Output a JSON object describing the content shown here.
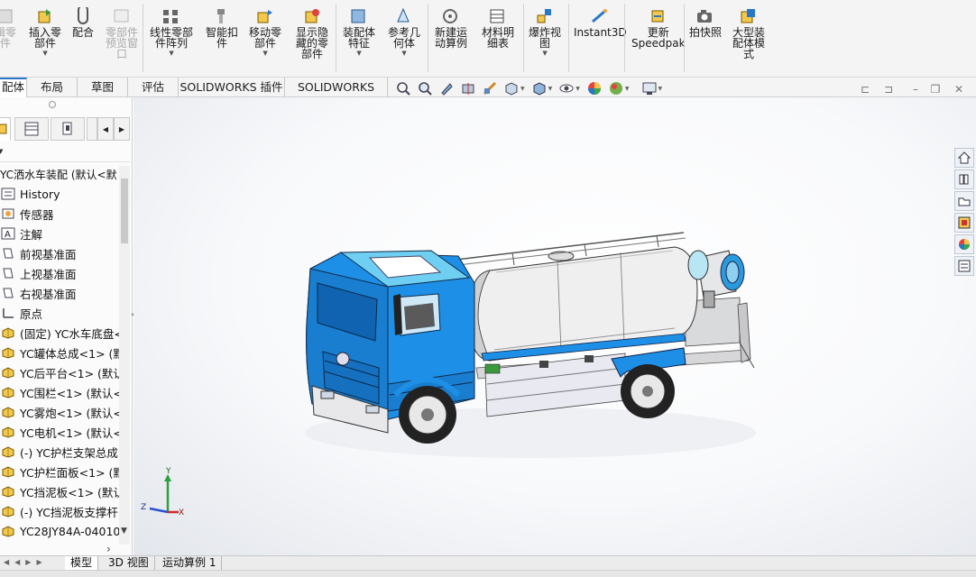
{
  "ribbon": {
    "buttons": [
      {
        "label": "插入零\n部件",
        "disabled": false,
        "icon": "insert-component-icon"
      },
      {
        "label": "配合",
        "disabled": false,
        "icon": "mate-icon"
      },
      {
        "label": "零部件\n预览窗\n口",
        "disabled": true,
        "icon": "component-preview-icon"
      },
      {
        "label": "线性零部\n件阵列",
        "disabled": false,
        "icon": "linear-pattern-icon"
      },
      {
        "label": "智能扣\n件",
        "disabled": false,
        "icon": "smart-fasteners-icon"
      },
      {
        "label": "移动零\n部件",
        "disabled": false,
        "icon": "move-component-icon"
      },
      {
        "label": "显示隐\n藏的零\n部件",
        "disabled": false,
        "icon": "show-hidden-icon"
      },
      {
        "label": "装配体\n特征",
        "disabled": false,
        "icon": "assembly-features-icon"
      },
      {
        "label": "参考几\n何体",
        "disabled": false,
        "icon": "reference-geometry-icon"
      },
      {
        "label": "新建运\n动算例",
        "disabled": false,
        "icon": "motion-study-icon"
      },
      {
        "label": "材料明\n细表",
        "disabled": false,
        "icon": "bom-icon"
      },
      {
        "label": "爆炸视\n图",
        "disabled": false,
        "icon": "exploded-view-icon"
      },
      {
        "label": "Instant3D",
        "disabled": false,
        "icon": "instant3d-icon"
      },
      {
        "label": "更新\nSpeedpak",
        "disabled": false,
        "icon": "speedpak-icon"
      },
      {
        "label": "拍快照",
        "disabled": false,
        "icon": "snapshot-icon"
      },
      {
        "label": "大型装\n配体模\n式",
        "disabled": false,
        "icon": "large-assembly-icon"
      }
    ],
    "partial_left_label": "辑零\n件"
  },
  "command_tabs": [
    "配体",
    "布局",
    "草图",
    "评估",
    "SOLIDWORKS 插件",
    "SOLIDWORKS MBD"
  ],
  "feature_tree": {
    "root": "YC洒水车装配  (默认<默",
    "items": [
      {
        "label": "History",
        "icon": "history-icon"
      },
      {
        "label": "传感器",
        "icon": "sensor-icon"
      },
      {
        "label": "注解",
        "icon": "annotation-icon"
      },
      {
        "label": "前视基准面",
        "icon": "plane-icon"
      },
      {
        "label": "上视基准面",
        "icon": "plane-icon"
      },
      {
        "label": "右视基准面",
        "icon": "plane-icon"
      },
      {
        "label": "原点",
        "icon": "origin-icon"
      },
      {
        "label": "(固定) YC水车底盘<",
        "icon": "part-icon"
      },
      {
        "label": "YC罐体总成<1> (默",
        "icon": "part-icon"
      },
      {
        "label": "YC后平台<1> (默认",
        "icon": "part-icon"
      },
      {
        "label": "YC围栏<1> (默认<",
        "icon": "part-icon"
      },
      {
        "label": "YC雾炮<1> (默认<",
        "icon": "part-icon"
      },
      {
        "label": "YC电机<1> (默认<",
        "icon": "part-icon"
      },
      {
        "label": "(-) YC护栏支架总成",
        "icon": "part-icon"
      },
      {
        "label": "YC护栏面板<1> (默",
        "icon": "part-icon"
      },
      {
        "label": "YC挡泥板<1> (默认",
        "icon": "part-icon"
      },
      {
        "label": "(-) YC挡泥板支撑杆",
        "icon": "part-icon"
      },
      {
        "label": "YC28JY84A-04010",
        "icon": "part-icon"
      }
    ]
  },
  "bottom_tabs": [
    "模型",
    "3D 视图",
    "运动算例 1"
  ],
  "triad": {
    "x": "X",
    "y": "Y",
    "z": "Z"
  },
  "colors": {
    "accent": "#2a77c9",
    "cab_blue": "#1e8fe6",
    "cab_light": "#7fd3f0",
    "tank": "#e9e9ec"
  }
}
